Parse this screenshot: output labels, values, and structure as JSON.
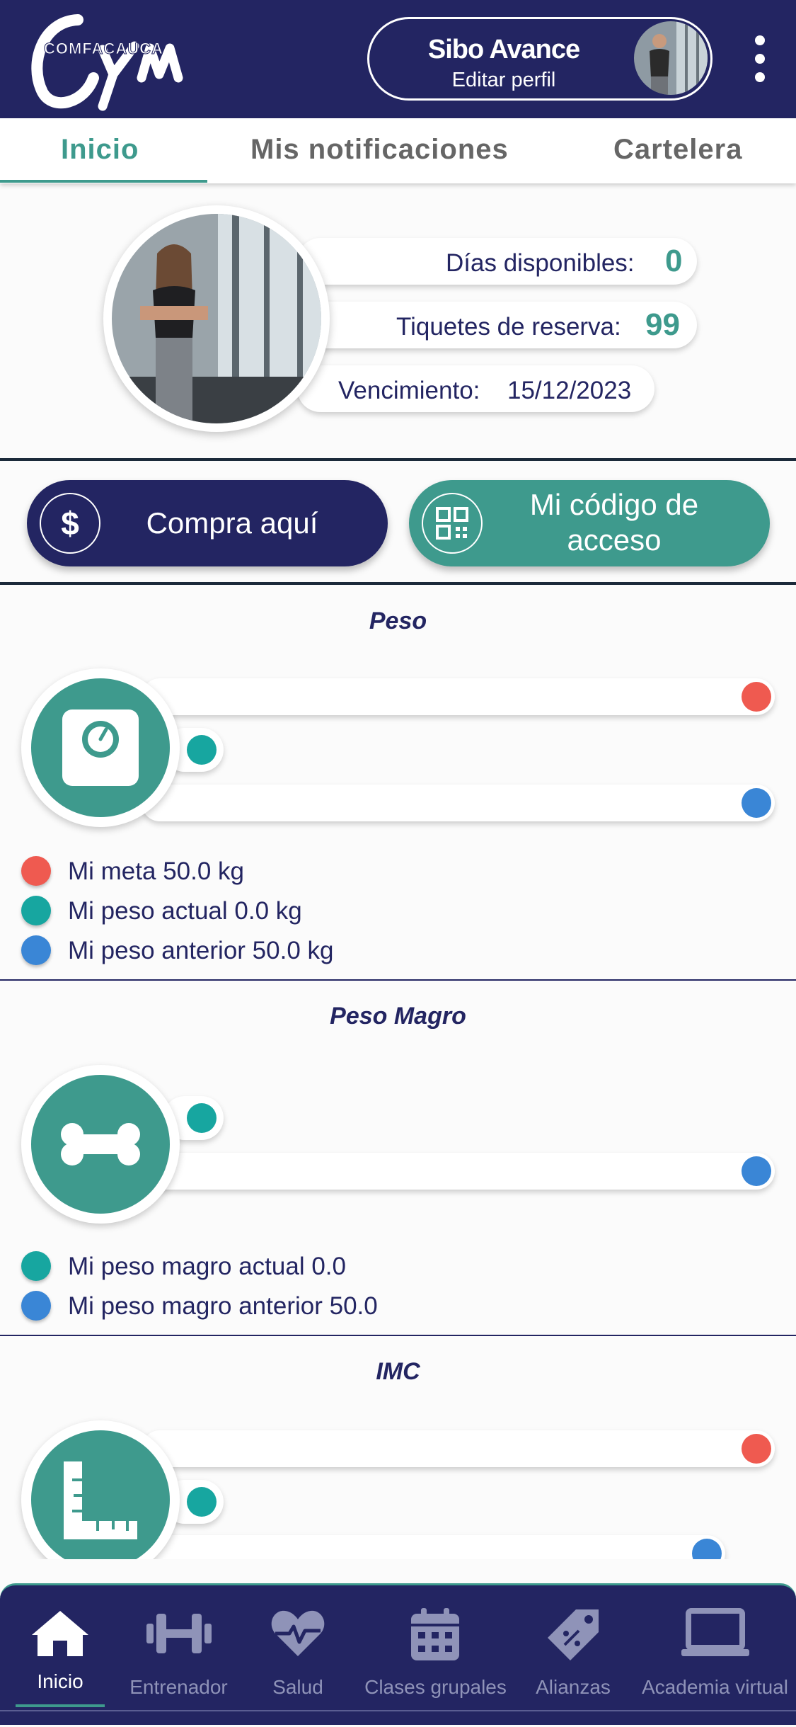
{
  "header": {
    "logo_text": "COMFACAUCA Gym",
    "profile_name": "Sibo Avance",
    "profile_action": "Editar perfil"
  },
  "tabs": [
    {
      "label": "Inicio",
      "active": true
    },
    {
      "label": "Mis notificaciones",
      "active": false
    },
    {
      "label": "Cartelera",
      "active": false
    }
  ],
  "membership": {
    "days_label": "Días disponibles:",
    "days_value": "0",
    "tickets_label": "Tiquetes de reserva:",
    "tickets_value": "99",
    "expiry_label": "Vencimiento:",
    "expiry_value": "15/12/2023"
  },
  "actions": {
    "buy_label": "Compra aquí",
    "access_label_line1": "Mi código de",
    "access_label_line2": "acceso"
  },
  "peso": {
    "title": "Peso",
    "legend": [
      {
        "label": "Mi meta 50.0 kg",
        "color": "#ef5a50"
      },
      {
        "label": "Mi peso actual 0.0 kg",
        "color": "#17a6a0"
      },
      {
        "label": "Mi peso anterior 50.0 kg",
        "color": "#3a86d6"
      }
    ]
  },
  "peso_magro": {
    "title": "Peso Magro",
    "legend": [
      {
        "label": "Mi peso magro actual 0.0",
        "color": "#17a6a0"
      },
      {
        "label": "Mi peso magro anterior 50.0",
        "color": "#3a86d6"
      }
    ]
  },
  "imc": {
    "title": "IMC"
  },
  "bottom_nav": [
    {
      "label": "Inicio",
      "icon": "home-icon",
      "active": true
    },
    {
      "label": "Entrenador",
      "icon": "dumbbell-icon",
      "active": false
    },
    {
      "label": "Salud",
      "icon": "heart-pulse-icon",
      "active": false
    },
    {
      "label": "Clases grupales",
      "icon": "calendar-icon",
      "active": false
    },
    {
      "label": "Alianzas",
      "icon": "tag-icon",
      "active": false
    },
    {
      "label": "Academia virtual",
      "icon": "laptop-icon",
      "active": false
    }
  ],
  "colors": {
    "primary": "#232562",
    "accent": "#3e9a8d",
    "goal": "#ef5a50",
    "current": "#17a6a0",
    "previous": "#3a86d6"
  }
}
